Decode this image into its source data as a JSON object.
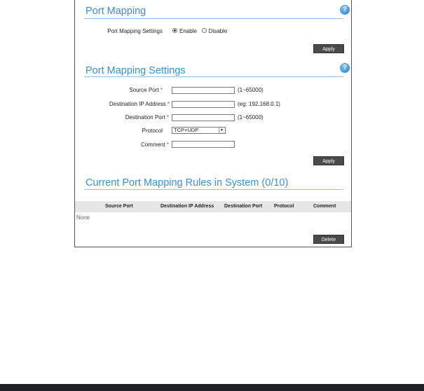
{
  "port_mapping": {
    "title": "Port Mapping",
    "settings_label": "Port Mapping Settings",
    "enable_label": "Enable",
    "disable_label": "Disable",
    "selected": "Enable",
    "apply_label": "Apply",
    "help_icon": "?"
  },
  "port_mapping_settings": {
    "title": "Port Mapping Settings",
    "help_icon": "?",
    "source_port_label": "Source Port",
    "source_port_value": "",
    "source_port_hint": "(1~65000)",
    "dest_ip_label": "Destination IP Address",
    "dest_ip_value": "",
    "dest_ip_hint": "(eg: 192.168.0.1)",
    "dest_port_label": "Destination Port",
    "dest_port_value": "",
    "dest_port_hint": "(1~65000)",
    "protocol_label": "Protocol",
    "protocol_value": "TCP+UDP",
    "comment_label": "Comment",
    "comment_value": "",
    "required_mark": "*",
    "apply_label": "Apply"
  },
  "rules": {
    "title": "Current Port Mapping Rules in System (0/10)",
    "columns": [
      "Source Port",
      "Destination IP Address",
      "Destination Port",
      "Protocol",
      "Comment"
    ],
    "empty_text": "None",
    "delete_label": "Delete"
  },
  "colors": {
    "accent": "#3a8fd4",
    "button": "#4a4a4a",
    "bottom_bar": "#1c1f26"
  }
}
